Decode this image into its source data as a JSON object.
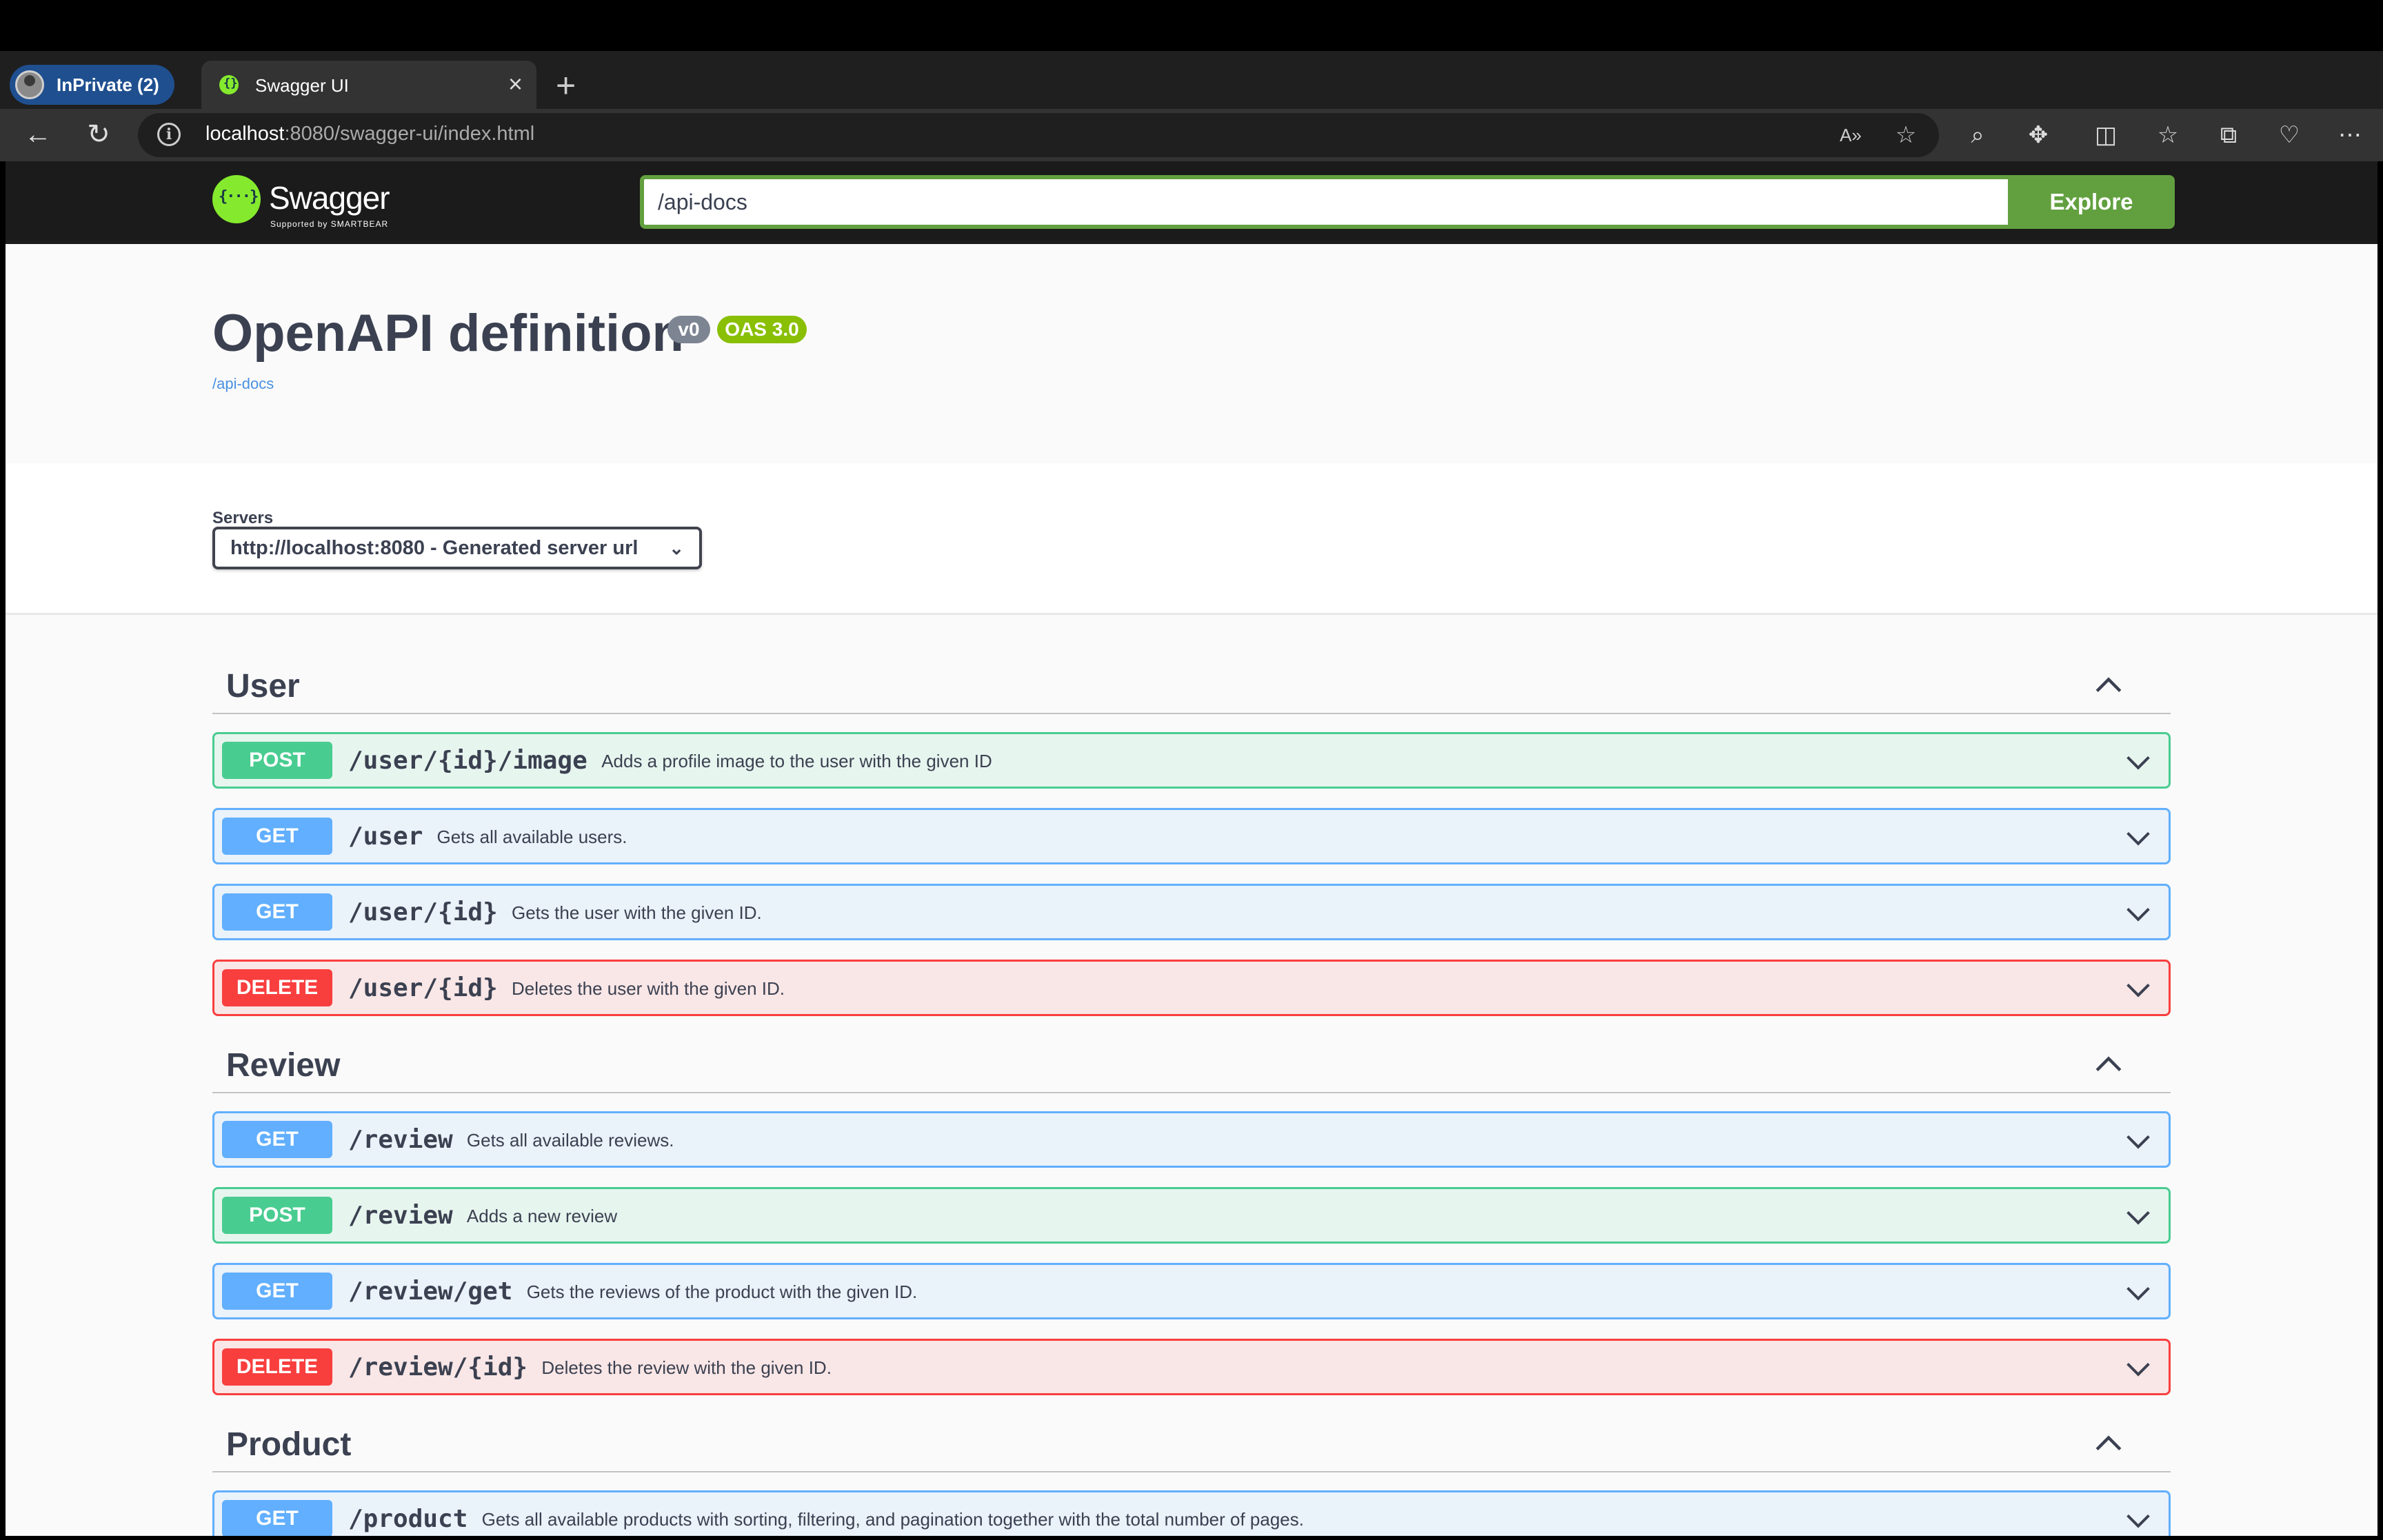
{
  "browser": {
    "profile_label": "InPrivate (2)",
    "tab_title": "Swagger UI",
    "url_host": "localhost",
    "url_rest": ":8080/swagger-ui/index.html"
  },
  "swagger": {
    "logo_word": "Swagger",
    "logo_sub": "Supported by SMARTBEAR",
    "search_value": "/api-docs",
    "explore_label": "Explore",
    "title": "OpenAPI definition",
    "version_badge": "v0",
    "oas_badge": "OAS 3.0",
    "spec_link": "/api-docs",
    "servers_label": "Servers",
    "servers_selected": "http://localhost:8080 - Generated server url"
  },
  "tags": [
    {
      "name": "User",
      "operations": [
        {
          "method": "POST",
          "path": "/user/{id}/image",
          "summary": "Adds a profile image to the user with the given ID"
        },
        {
          "method": "GET",
          "path": "/user",
          "summary": "Gets all available users."
        },
        {
          "method": "GET",
          "path": "/user/{id}",
          "summary": "Gets the user with the given ID."
        },
        {
          "method": "DELETE",
          "path": "/user/{id}",
          "summary": "Deletes the user with the given ID."
        }
      ]
    },
    {
      "name": "Review",
      "operations": [
        {
          "method": "GET",
          "path": "/review",
          "summary": "Gets all available reviews."
        },
        {
          "method": "POST",
          "path": "/review",
          "summary": "Adds a new review"
        },
        {
          "method": "GET",
          "path": "/review/get",
          "summary": "Gets the reviews of the product with the given ID."
        },
        {
          "method": "DELETE",
          "path": "/review/{id}",
          "summary": "Deletes the review with the given ID."
        }
      ]
    },
    {
      "name": "Product",
      "operations": [
        {
          "method": "GET",
          "path": "/product",
          "summary": "Gets all available products with sorting, filtering, and pagination together with the total number of pages."
        }
      ]
    }
  ],
  "colors": {
    "post": "#49cc90",
    "get": "#61affe",
    "delete": "#f93e3e",
    "explore": "#62a03f",
    "oas_badge": "#89bf04"
  }
}
